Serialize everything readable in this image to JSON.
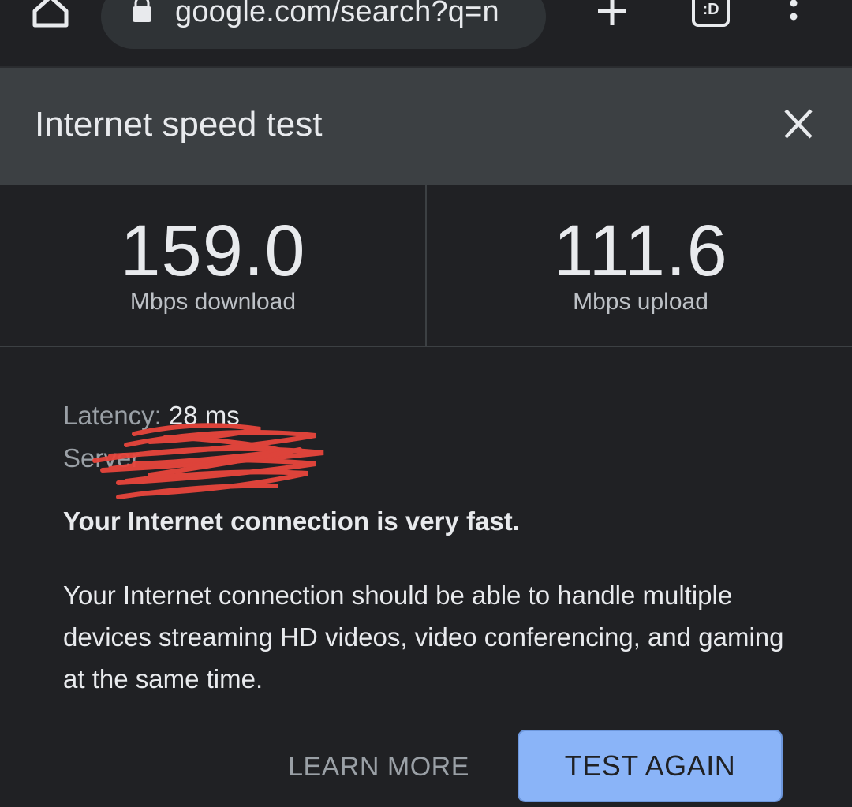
{
  "browser": {
    "url": "google.com/search?q=n",
    "tab_badge": ":D"
  },
  "dialog": {
    "title": "Internet speed test"
  },
  "metrics": {
    "download": {
      "value": "159.0",
      "label": "Mbps download"
    },
    "upload": {
      "value": "111.6",
      "label": "Mbps upload"
    }
  },
  "details": {
    "latency_label": "Latency: ",
    "latency_value": "28 ms",
    "server_label": "Server"
  },
  "result": {
    "verdict": "Your Internet connection is very fast.",
    "description": "Your Internet connection should be able to handle multiple devices streaming HD videos, video conferencing, and gaming at the same time."
  },
  "actions": {
    "learn_more": "LEARN MORE",
    "test_again": "TEST AGAIN"
  },
  "colors": {
    "background": "#202124",
    "header": "#3c4043",
    "accent_button": "#8ab4f8",
    "redaction": "#e8453c"
  },
  "icons": [
    "home-icon",
    "lock-icon",
    "plus-icon",
    "tabs-icon",
    "more-vert-icon",
    "close-icon"
  ]
}
